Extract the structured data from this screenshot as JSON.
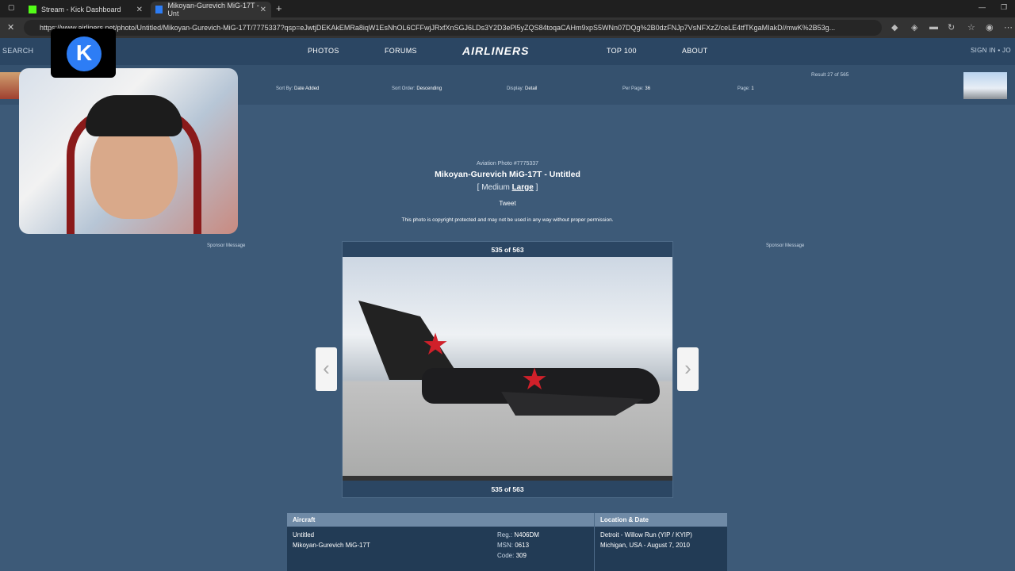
{
  "browser": {
    "tabs": [
      {
        "title": "Stream - Kick Dashboard"
      },
      {
        "title": "Mikoyan-Gurevich MiG-17T - Unt"
      }
    ],
    "url": "https://www.airliners.net/photo/Untitled/Mikoyan-Gurevich-MiG-17T/7775337?qsp=eJwtjDEKAkEMRa8iqW1EsNhOL6CFFwjJRxfXnSGJ6LDs3Y2D3ePl5yZQS84toqaCAHm9xpS5WNn07DQg%2B0dzFNJp7VsNFXzZ/ceLE4tfTKgaMIakD//mwK%2B53g..."
  },
  "nav": {
    "search": "SEARCH",
    "photos": "PHOTOS",
    "forums": "FORUMS",
    "logo": "AIRLINERS",
    "top100": "TOP 100",
    "about": "ABOUT",
    "signin": "SIGN IN • JO"
  },
  "filters": {
    "sort_by_label": "Sort By:",
    "sort_by_value": "Date Added",
    "sort_order_label": "Sort Order:",
    "sort_order_value": "Descending",
    "display_label": "Display:",
    "display_value": "Detail",
    "per_page_label": "Per Page:",
    "per_page_value": "36",
    "page_label": "Page:",
    "page_value": "1",
    "result": "Result 27 of 565"
  },
  "photo": {
    "label": "Aviation Photo #7775337",
    "title": "Mikoyan-Gurevich MiG-17T - Untitled",
    "size_medium": "Medium",
    "size_large": "Large",
    "tweet": "Tweet",
    "copyright": "This photo is copyright protected and may not be used in any way without proper permission.",
    "sponsor": "Sponsor Message",
    "counter": "535 of 563"
  },
  "details": {
    "aircraft_header": "Aircraft",
    "location_header": "Location & Date",
    "operator": "Untitled",
    "type": "Mikoyan-Gurevich MiG-17T",
    "reg_label": "Reg.:",
    "reg": "N406DM",
    "msn_label": "MSN:",
    "msn": "0613",
    "code_label": "Code:",
    "code": "309",
    "location": "Detroit - Willow Run (YIP / KYIP)",
    "date": "Michigan, USA - August 7, 2010"
  },
  "colors": {
    "page_bg": "#3d5a78",
    "nav_bg": "#2b4663",
    "accent_red": "#d0202a",
    "kick_green": "#53fc18"
  }
}
